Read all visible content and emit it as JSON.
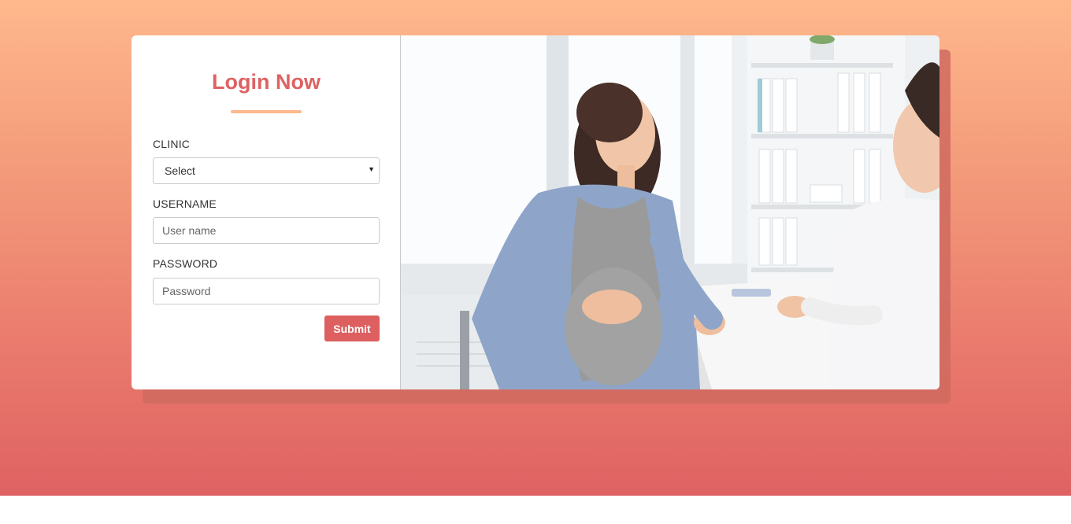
{
  "login": {
    "title": "Login Now",
    "clinic_label": "CLINIC",
    "clinic_selected": "Select",
    "username_label": "USERNAME",
    "username_placeholder": "User name",
    "password_label": "PASSWORD",
    "password_placeholder": "Password",
    "submit_label": "Submit"
  },
  "colors": {
    "accent": "#de6262",
    "underline": "#ffb88c",
    "gradient_top": "#ffb88c",
    "gradient_bottom": "#de6262"
  },
  "image": {
    "icon": "clinic-photo"
  }
}
